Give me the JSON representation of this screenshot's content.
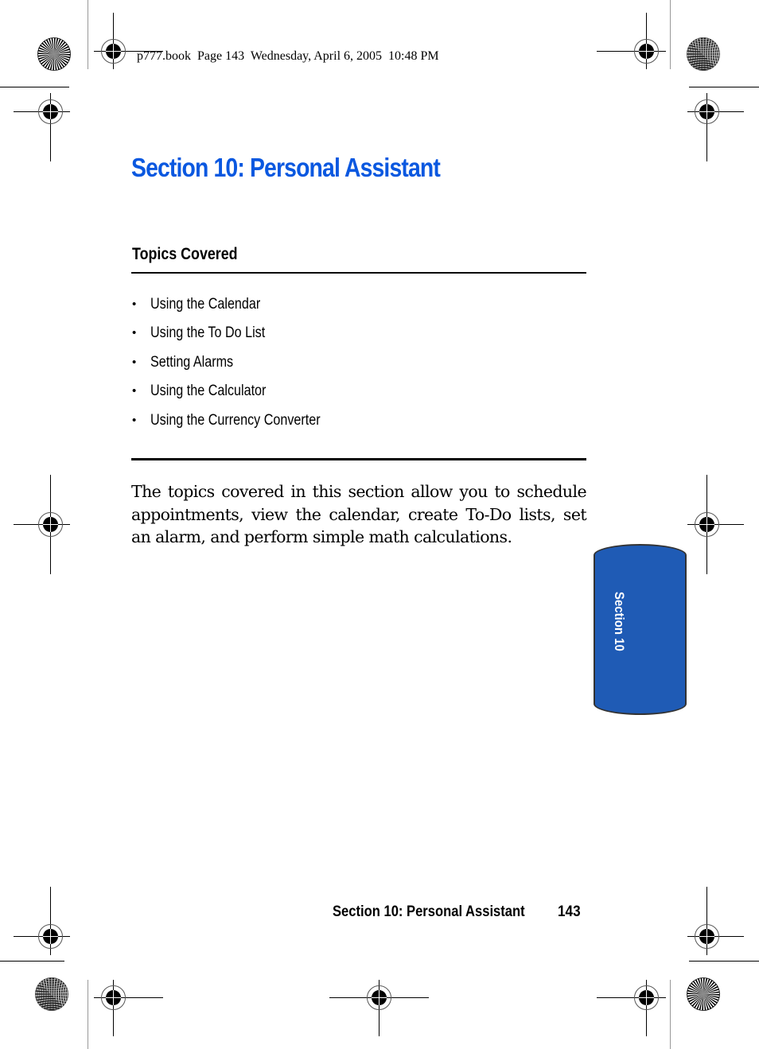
{
  "print_header": {
    "stamp": "p777.book  Page 143  Wednesday, April 6, 2005  10:48 PM"
  },
  "page": {
    "title": "Section 10: Personal Assistant",
    "topics_heading": "Topics Covered",
    "topics": [
      "Using the Calendar",
      "Using the To Do List",
      "Setting Alarms",
      "Using the Calculator",
      "Using the Currency Converter"
    ],
    "bullet": "•",
    "body": "The topics covered in this section allow you to schedule appointments, view the calendar, create To-Do lists, set an alarm, and perform simple math calculations."
  },
  "side_tab": {
    "label": "Section 10",
    "color": "#1f5bb5"
  },
  "footer": {
    "section_title": "Section 10: Personal Assistant",
    "page_number": "143"
  },
  "colors": {
    "title": "#0a58e0",
    "text": "#000000"
  },
  "icons": {
    "registration_mark": "crosshair-target-icon",
    "starburst": "starburst-calibration-icon",
    "moire": "moire-calibration-icon"
  }
}
